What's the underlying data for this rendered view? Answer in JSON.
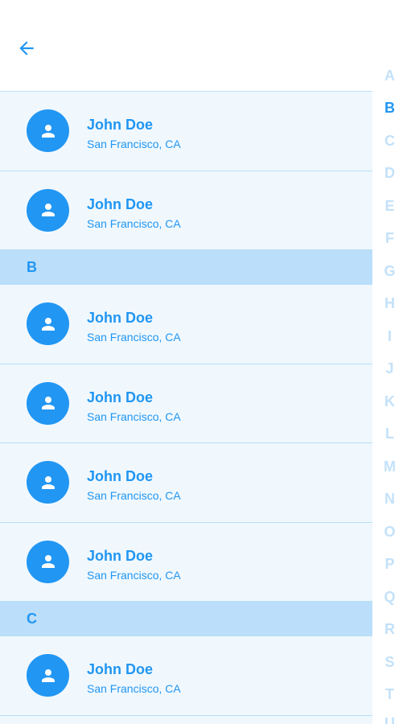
{
  "header": {
    "back_icon": "arrow-left-icon"
  },
  "colors": {
    "accent": "#2196f3",
    "row_bg": "#f0f8fe",
    "section_bg": "#bbdffb",
    "index_inactive": "#c3e1f9"
  },
  "list": {
    "rows_a": [
      {
        "name": "John Doe",
        "location": "San Francisco, CA"
      },
      {
        "name": "John Doe",
        "location": "San Francisco, CA"
      }
    ],
    "section_b": "B",
    "rows_b": [
      {
        "name": "John Doe",
        "location": "San Francisco, CA"
      },
      {
        "name": "John Doe",
        "location": "San Francisco, CA"
      },
      {
        "name": "John Doe",
        "location": "San Francisco, CA"
      },
      {
        "name": "John Doe",
        "location": "San Francisco, CA"
      }
    ],
    "section_c": "C",
    "rows_c": [
      {
        "name": "John Doe",
        "location": "San Francisco, CA"
      }
    ]
  },
  "index": {
    "active": "B",
    "letters": [
      "A",
      "B",
      "C",
      "D",
      "E",
      "F",
      "G",
      "H",
      "I",
      "J",
      "K",
      "L",
      "M",
      "N",
      "O",
      "P",
      "Q",
      "R",
      "S",
      "T",
      "U"
    ]
  }
}
